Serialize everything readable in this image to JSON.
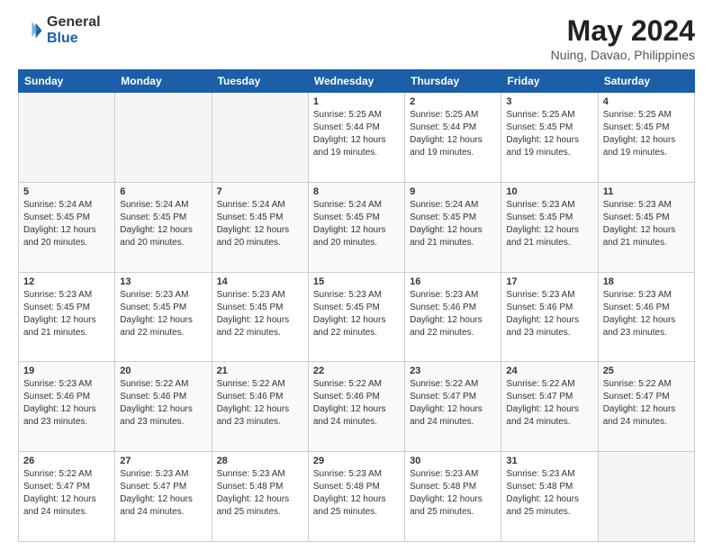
{
  "logo": {
    "general": "General",
    "blue": "Blue"
  },
  "title": "May 2024",
  "subtitle": "Nuing, Davao, Philippines",
  "days": [
    "Sunday",
    "Monday",
    "Tuesday",
    "Wednesday",
    "Thursday",
    "Friday",
    "Saturday"
  ],
  "weeks": [
    [
      {
        "num": "",
        "info": ""
      },
      {
        "num": "",
        "info": ""
      },
      {
        "num": "",
        "info": ""
      },
      {
        "num": "1",
        "info": "Sunrise: 5:25 AM\nSunset: 5:44 PM\nDaylight: 12 hours\nand 19 minutes."
      },
      {
        "num": "2",
        "info": "Sunrise: 5:25 AM\nSunset: 5:44 PM\nDaylight: 12 hours\nand 19 minutes."
      },
      {
        "num": "3",
        "info": "Sunrise: 5:25 AM\nSunset: 5:45 PM\nDaylight: 12 hours\nand 19 minutes."
      },
      {
        "num": "4",
        "info": "Sunrise: 5:25 AM\nSunset: 5:45 PM\nDaylight: 12 hours\nand 19 minutes."
      }
    ],
    [
      {
        "num": "5",
        "info": "Sunrise: 5:24 AM\nSunset: 5:45 PM\nDaylight: 12 hours\nand 20 minutes."
      },
      {
        "num": "6",
        "info": "Sunrise: 5:24 AM\nSunset: 5:45 PM\nDaylight: 12 hours\nand 20 minutes."
      },
      {
        "num": "7",
        "info": "Sunrise: 5:24 AM\nSunset: 5:45 PM\nDaylight: 12 hours\nand 20 minutes."
      },
      {
        "num": "8",
        "info": "Sunrise: 5:24 AM\nSunset: 5:45 PM\nDaylight: 12 hours\nand 20 minutes."
      },
      {
        "num": "9",
        "info": "Sunrise: 5:24 AM\nSunset: 5:45 PM\nDaylight: 12 hours\nand 21 minutes."
      },
      {
        "num": "10",
        "info": "Sunrise: 5:23 AM\nSunset: 5:45 PM\nDaylight: 12 hours\nand 21 minutes."
      },
      {
        "num": "11",
        "info": "Sunrise: 5:23 AM\nSunset: 5:45 PM\nDaylight: 12 hours\nand 21 minutes."
      }
    ],
    [
      {
        "num": "12",
        "info": "Sunrise: 5:23 AM\nSunset: 5:45 PM\nDaylight: 12 hours\nand 21 minutes."
      },
      {
        "num": "13",
        "info": "Sunrise: 5:23 AM\nSunset: 5:45 PM\nDaylight: 12 hours\nand 22 minutes."
      },
      {
        "num": "14",
        "info": "Sunrise: 5:23 AM\nSunset: 5:45 PM\nDaylight: 12 hours\nand 22 minutes."
      },
      {
        "num": "15",
        "info": "Sunrise: 5:23 AM\nSunset: 5:45 PM\nDaylight: 12 hours\nand 22 minutes."
      },
      {
        "num": "16",
        "info": "Sunrise: 5:23 AM\nSunset: 5:46 PM\nDaylight: 12 hours\nand 22 minutes."
      },
      {
        "num": "17",
        "info": "Sunrise: 5:23 AM\nSunset: 5:46 PM\nDaylight: 12 hours\nand 23 minutes."
      },
      {
        "num": "18",
        "info": "Sunrise: 5:23 AM\nSunset: 5:46 PM\nDaylight: 12 hours\nand 23 minutes."
      }
    ],
    [
      {
        "num": "19",
        "info": "Sunrise: 5:23 AM\nSunset: 5:46 PM\nDaylight: 12 hours\nand 23 minutes."
      },
      {
        "num": "20",
        "info": "Sunrise: 5:22 AM\nSunset: 5:46 PM\nDaylight: 12 hours\nand 23 minutes."
      },
      {
        "num": "21",
        "info": "Sunrise: 5:22 AM\nSunset: 5:46 PM\nDaylight: 12 hours\nand 23 minutes."
      },
      {
        "num": "22",
        "info": "Sunrise: 5:22 AM\nSunset: 5:46 PM\nDaylight: 12 hours\nand 24 minutes."
      },
      {
        "num": "23",
        "info": "Sunrise: 5:22 AM\nSunset: 5:47 PM\nDaylight: 12 hours\nand 24 minutes."
      },
      {
        "num": "24",
        "info": "Sunrise: 5:22 AM\nSunset: 5:47 PM\nDaylight: 12 hours\nand 24 minutes."
      },
      {
        "num": "25",
        "info": "Sunrise: 5:22 AM\nSunset: 5:47 PM\nDaylight: 12 hours\nand 24 minutes."
      }
    ],
    [
      {
        "num": "26",
        "info": "Sunrise: 5:22 AM\nSunset: 5:47 PM\nDaylight: 12 hours\nand 24 minutes."
      },
      {
        "num": "27",
        "info": "Sunrise: 5:23 AM\nSunset: 5:47 PM\nDaylight: 12 hours\nand 24 minutes."
      },
      {
        "num": "28",
        "info": "Sunrise: 5:23 AM\nSunset: 5:48 PM\nDaylight: 12 hours\nand 25 minutes."
      },
      {
        "num": "29",
        "info": "Sunrise: 5:23 AM\nSunset: 5:48 PM\nDaylight: 12 hours\nand 25 minutes."
      },
      {
        "num": "30",
        "info": "Sunrise: 5:23 AM\nSunset: 5:48 PM\nDaylight: 12 hours\nand 25 minutes."
      },
      {
        "num": "31",
        "info": "Sunrise: 5:23 AM\nSunset: 5:48 PM\nDaylight: 12 hours\nand 25 minutes."
      },
      {
        "num": "",
        "info": ""
      }
    ]
  ]
}
